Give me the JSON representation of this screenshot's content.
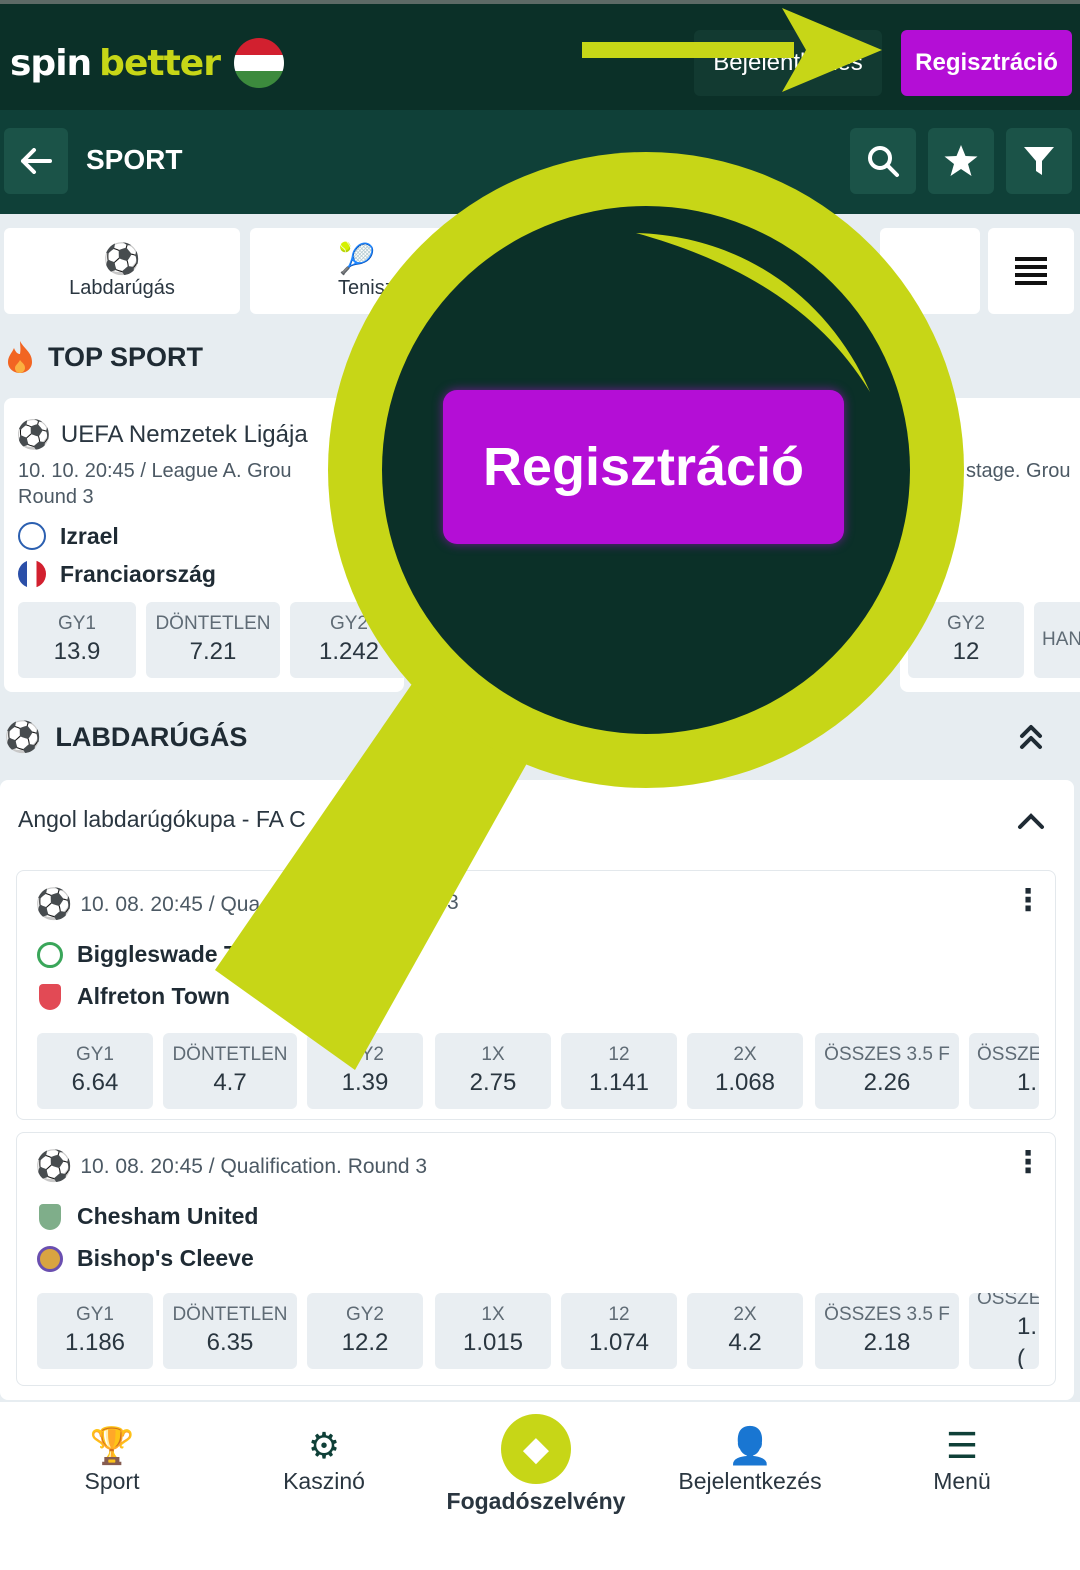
{
  "header": {
    "logo_spin": "spin",
    "logo_better": "better",
    "login_label": "Bejelentkezés",
    "register_label": "Regisztráció"
  },
  "navbar": {
    "title": "SPORT"
  },
  "sport_tabs": [
    {
      "label": "Labdarúgás",
      "icon": "soccer-ball-icon"
    },
    {
      "label": "Tenisz",
      "icon": "tennis-ball-icon"
    }
  ],
  "top_sport": {
    "title": "TOP SPORT",
    "match": {
      "league": "UEFA Nemzetek Ligája",
      "meta_line1": "10. 10. 20:45 / League A. Grou",
      "meta_line2": "Round 3",
      "team1": "Izrael",
      "team2": "Franciaország",
      "odds": [
        {
          "label": "GY1",
          "value": "13.9"
        },
        {
          "label": "DÖNTETLEN",
          "value": "7.21"
        },
        {
          "label": "GY2",
          "value": "1.242"
        }
      ]
    },
    "second_card": {
      "meta": "stage. Grou",
      "odds": [
        {
          "label": "GY2",
          "value": "12"
        },
        {
          "label": "HAN",
          "value": ""
        }
      ]
    }
  },
  "football": {
    "title": "LABDARÚGÁS",
    "competition": "Angol labdarúgókupa - FA C",
    "matches": [
      {
        "meta": "10. 08. 20:45 / Qua",
        "meta_tail": "3",
        "team1": "Biggleswade T",
        "team2": "Alfreton Town",
        "odds": [
          {
            "label": "GY1",
            "value": "6.64"
          },
          {
            "label": "DÖNTETLEN",
            "value": "4.7"
          },
          {
            "label": "GY2",
            "value": "1.39"
          },
          {
            "label": "1X",
            "value": "2.75"
          },
          {
            "label": "12",
            "value": "1.141"
          },
          {
            "label": "2X",
            "value": "1.068"
          },
          {
            "label": "ÖSSZES 3.5 F",
            "value": "2.26"
          },
          {
            "label": "ÖSSZE",
            "value": "1."
          }
        ]
      },
      {
        "meta": "10. 08. 20:45 / Qualification. Round 3",
        "meta_tail": "",
        "team1": "Chesham United",
        "team2": "Bishop's Cleeve",
        "odds": [
          {
            "label": "GY1",
            "value": "1.186"
          },
          {
            "label": "DÖNTETLEN",
            "value": "6.35"
          },
          {
            "label": "GY2",
            "value": "12.2"
          },
          {
            "label": "1X",
            "value": "1.015"
          },
          {
            "label": "12",
            "value": "1.074"
          },
          {
            "label": "2X",
            "value": "4.2"
          },
          {
            "label": "ÖSSZES 3.5 F",
            "value": "2.18"
          },
          {
            "label": "ÖSSZE",
            "value": "1.("
          }
        ]
      }
    ]
  },
  "bottom_nav": [
    {
      "label": "Sport",
      "icon": "trophy-icon"
    },
    {
      "label": "Kaszinó",
      "icon": "casino-chip-icon"
    },
    {
      "label": "Fogadószelvény",
      "icon": "bet-slip-icon"
    },
    {
      "label": "Bejelentkezés",
      "icon": "user-icon"
    },
    {
      "label": "Menü",
      "icon": "hamburger-icon"
    }
  ],
  "overlay": {
    "zoom_label": "Regisztráció",
    "accent_color": "#c7d617",
    "register_color": "#b40ed6"
  },
  "colors": {
    "header_bg": "#0b3028",
    "navbar_bg": "#0f4038",
    "page_bg": "#e7edf1"
  }
}
